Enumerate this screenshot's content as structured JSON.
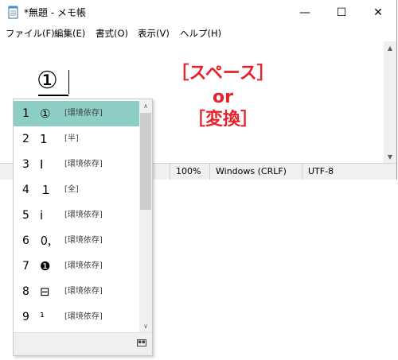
{
  "window": {
    "title": "*無題 - メモ帳",
    "controls": {
      "minimize": "—",
      "maximize": "☐",
      "close": "✕"
    }
  },
  "menu": [
    "ファイル(F)",
    "編集(E)",
    "書式(O)",
    "表示(V)",
    "ヘルプ(H)"
  ],
  "editor": {
    "typed_text": "①"
  },
  "scrollbar": {
    "up": "▲",
    "down": "▼"
  },
  "statusbar": {
    "zoom": "100%",
    "line_ending": "Windows (CRLF)",
    "encoding": "UTF-8"
  },
  "annotation": {
    "line1": "［スペース］",
    "line2": "or",
    "line3": "［変換］",
    "color": "#e8202a"
  },
  "ime": {
    "selected_index": 0,
    "selected_color": "#8ecfc5",
    "candidates": [
      {
        "num": "1",
        "glyph": "①",
        "tag": "[環境依存]"
      },
      {
        "num": "2",
        "glyph": "1",
        "tag": "[半]"
      },
      {
        "num": "3",
        "glyph": "Ⅰ",
        "tag": "[環境依存]"
      },
      {
        "num": "4",
        "glyph": "１",
        "tag": "[全]"
      },
      {
        "num": "5",
        "glyph": "ⅰ",
        "tag": "[環境依存]"
      },
      {
        "num": "6",
        "glyph": "🄁",
        "tag": "[環境依存]"
      },
      {
        "num": "7",
        "glyph": "❶",
        "tag": "[環境依存]"
      },
      {
        "num": "8",
        "glyph": "⊟",
        "tag": "[環境依存]"
      },
      {
        "num": "9",
        "glyph": "¹",
        "tag": "[環境依存]"
      }
    ],
    "scroll_up": "∧",
    "scroll_down": "∨",
    "footer_icon": "keyboard-toggle-icon"
  }
}
